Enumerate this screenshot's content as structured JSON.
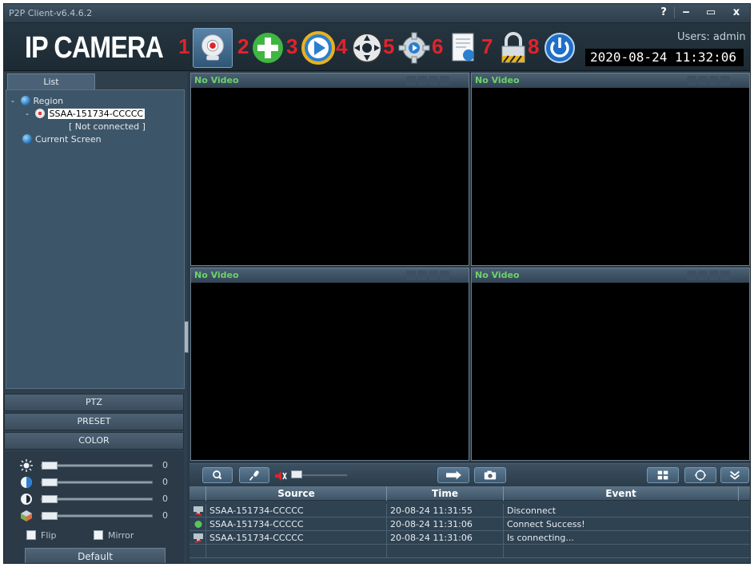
{
  "titlebar": {
    "title": "P2P Client-v6.4.6.2",
    "help": "?",
    "minimize": "‒",
    "maximize": "▭",
    "close": "x"
  },
  "header": {
    "brand": "IP CAMERA",
    "toolbar": [
      {
        "number": "1",
        "icon": "camera-icon"
      },
      {
        "number": "2",
        "icon": "add-icon"
      },
      {
        "number": "3",
        "icon": "playback-icon"
      },
      {
        "number": "4",
        "icon": "ptz-icon"
      },
      {
        "number": "5",
        "icon": "settings-gear-icon"
      },
      {
        "number": "6",
        "icon": "log-document-icon"
      },
      {
        "number": "7",
        "icon": "lock-icon"
      },
      {
        "number": "8",
        "icon": "power-icon"
      }
    ],
    "users": "Users: admin",
    "datetime": "2020-08-24 11:32:06"
  },
  "left": {
    "tab": "List",
    "tree": {
      "region_toggle": "-",
      "region": "Region",
      "device_toggle": "-",
      "device": "SSAA-151734-CCCCC",
      "status": "[   Not connected   ]",
      "current_screen": "Current Screen"
    },
    "sections": [
      "PTZ",
      "PRESET",
      "COLOR"
    ],
    "color": {
      "sliders": [
        {
          "icon": "brightness-icon",
          "value": "0"
        },
        {
          "icon": "contrast-icon",
          "value": "0"
        },
        {
          "icon": "saturation-icon",
          "value": "0"
        },
        {
          "icon": "hue-icon",
          "value": "0"
        }
      ],
      "flip": "Flip",
      "mirror": "Mirror",
      "default": "Default"
    }
  },
  "videos": [
    {
      "label": "No Video"
    },
    {
      "label": "No Video"
    },
    {
      "label": "No Video"
    },
    {
      "label": "No Video"
    }
  ],
  "events": {
    "columns": [
      "Source",
      "Time",
      "Event"
    ],
    "rows": [
      {
        "icon": "disconnect-icon",
        "source": "SSAA-151734-CCCCC",
        "time": "20-08-24 11:31:55",
        "event": "Disconnect"
      },
      {
        "icon": "success-icon",
        "source": "SSAA-151734-CCCCC",
        "time": "20-08-24 11:31:06",
        "event": "Connect Success!"
      },
      {
        "icon": "connecting-icon",
        "source": "SSAA-151734-CCCCC",
        "time": "20-08-24 11:31:06",
        "event": "Is connecting..."
      }
    ]
  },
  "colors": {
    "accent_red": "#e3222a",
    "video_label_green": "#6bd36b",
    "panel_bg": "#2b3a46"
  }
}
